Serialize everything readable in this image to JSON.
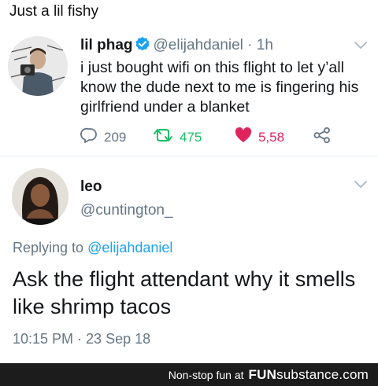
{
  "post_title": "Just a lil fishy",
  "tweet1": {
    "name": "lil phag",
    "handle": "@elijahdaniel",
    "separator": "·",
    "time": "1h",
    "body": "i just bought wifi on this flight to let y’all know the dude next to me is fingering his girlfriend under a blanket",
    "replies": "209",
    "retweets": "475",
    "likes": "5,58"
  },
  "tweet2": {
    "name": "leo",
    "handle": "@cuntington_",
    "replying_prefix": "Replying to",
    "replying_to": "@elijahdaniel",
    "body": "Ask the flight attendant why it smells like shrimp tacos",
    "timestamp": "10:15 PM · 23 Sep 18"
  },
  "footer": {
    "text": "Non-stop fun at",
    "brand_fun": "FUN",
    "brand_sub": "substance",
    "brand_com": ".com"
  },
  "colors": {
    "like": "#e0245e",
    "retweet": "#17bf63",
    "mention": "#1da1f2",
    "muted": "#657786",
    "verified": "#1da1f2"
  },
  "icons": [
    "verified-badge-icon",
    "chevron-down-icon",
    "reply-icon",
    "retweet-icon",
    "heart-icon",
    "share-icon"
  ]
}
